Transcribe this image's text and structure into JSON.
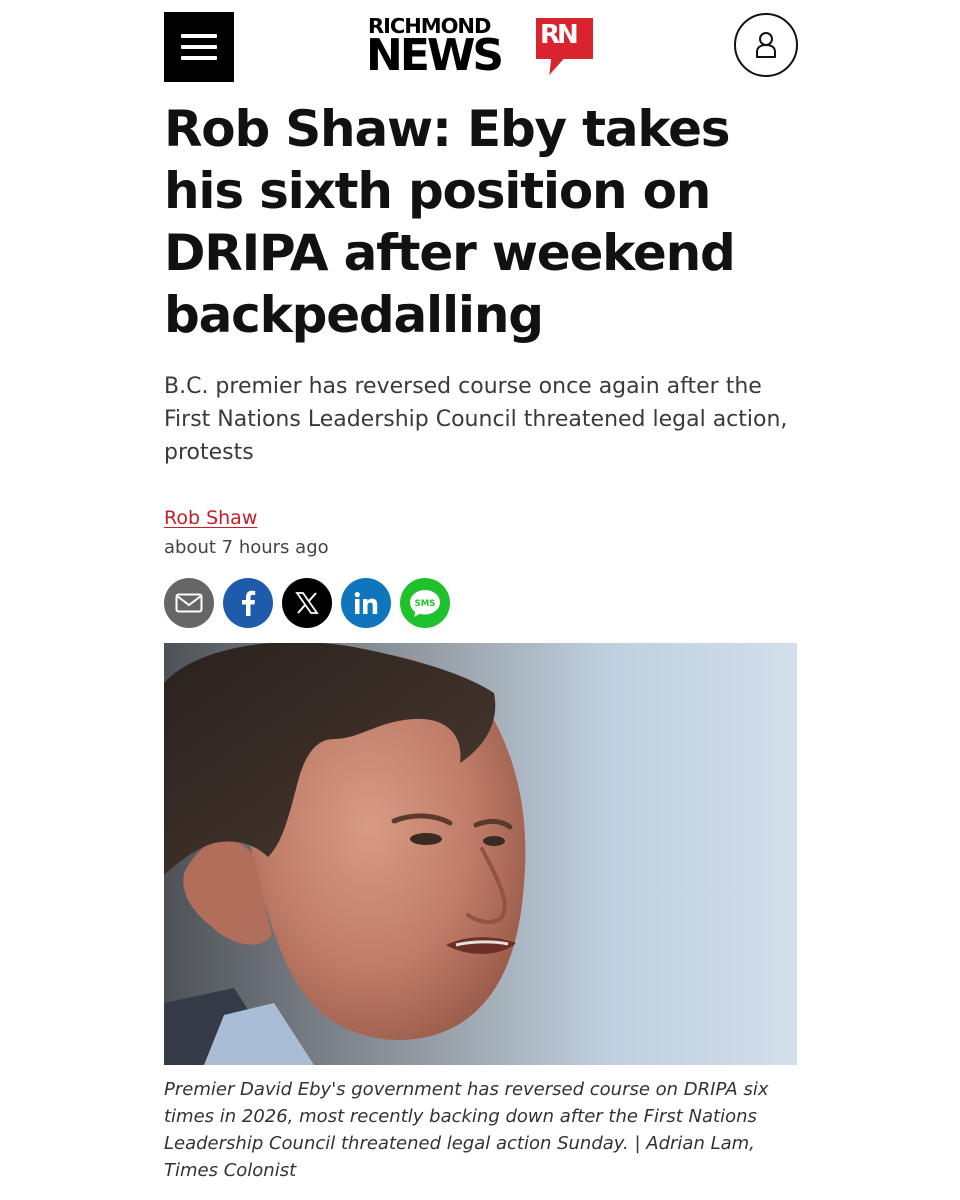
{
  "header": {
    "menu_icon": "hamburger-menu-icon",
    "account_icon": "user-account-icon",
    "logo": {
      "line1": "RICHMOND",
      "line2": "NEWS",
      "mark": "RN",
      "colors": {
        "text": "#000000",
        "mark": "#d9232e"
      }
    }
  },
  "article": {
    "headline": "Rob Shaw: Eby takes his sixth position on DRIPA after weekend backpedalling",
    "dek": "B.C. premier has reversed course once again after the First Nations Leadership Council threatened legal action, protests",
    "author": "Rob Shaw",
    "timestamp": "about 7 hours ago",
    "share": [
      {
        "name": "email",
        "icon": "envelope-icon",
        "color": "#666666"
      },
      {
        "name": "facebook",
        "icon": "facebook-icon",
        "color": "#1f5bab"
      },
      {
        "name": "x",
        "icon": "x-logo-icon",
        "color": "#000000"
      },
      {
        "name": "linkedin",
        "icon": "linkedin-icon",
        "color": "#0f75bd"
      },
      {
        "name": "sms",
        "label": "SMS",
        "icon": "sms-bubble-icon",
        "color": "#1fc12c"
      }
    ],
    "photo_caption": "Premier David Eby's government has reversed course on DRIPA six times in 2026, most recently backing down after the First Nations Leadership Council threatened legal action Sunday. | Adrian Lam, Times Colonist"
  },
  "colors": {
    "author_link": "#c0212b",
    "text": "#111111",
    "muted": "#444444"
  }
}
